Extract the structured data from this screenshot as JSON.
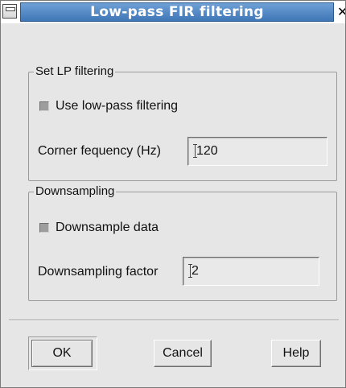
{
  "window": {
    "title": "Low-pass FIR filtering",
    "close_glyph": "✕"
  },
  "lp_group": {
    "legend": "Set LP filtering",
    "checkbox_label": "Use low-pass filtering",
    "checkbox_checked": false,
    "field_label": "Corner fequency (Hz)",
    "field_value": "120"
  },
  "ds_group": {
    "legend": "Downsampling",
    "checkbox_label": "Downsample data",
    "checkbox_checked": false,
    "field_label": "Downsampling factor",
    "field_value": "2"
  },
  "buttons": {
    "ok": "OK",
    "cancel": "Cancel",
    "help": "Help"
  },
  "icons": {
    "window_menu": "window-menu-icon",
    "close": "close-icon",
    "text_cursor": "text-cursor-icon"
  }
}
